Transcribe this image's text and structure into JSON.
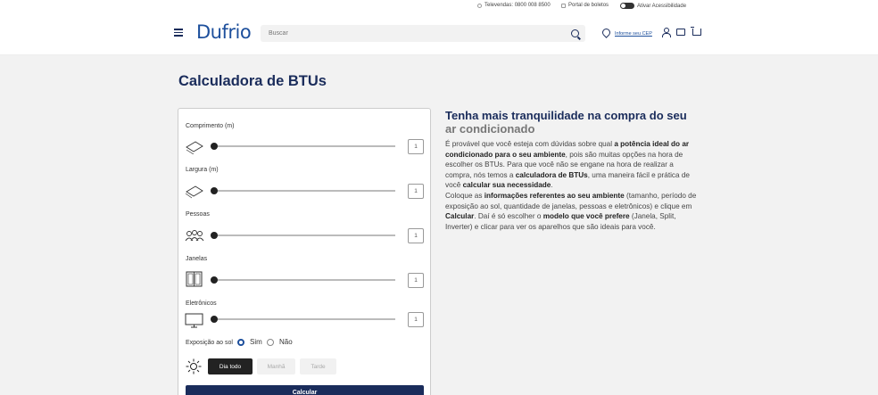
{
  "topbar": {
    "televendas": "Televendas: 0800 008 8500",
    "portal": "Portal de boletos",
    "acessibilidade": "Ativar Acessibilidade"
  },
  "header": {
    "logo": "Dufrio",
    "search_placeholder": "Buscar",
    "cep_link": "Informe seu CEP",
    "brand_color": "#1a2c5b"
  },
  "page_title": "Calculadora de BTUs",
  "calculator": {
    "fields": [
      {
        "label": "Comprimento (m)",
        "value": "1",
        "icon": "length-icon"
      },
      {
        "label": "Largura (m)",
        "value": "1",
        "icon": "width-icon"
      },
      {
        "label": "Pessoas",
        "value": "1",
        "icon": "people-icon"
      },
      {
        "label": "Janelas",
        "value": "1",
        "icon": "window-icon"
      },
      {
        "label": "Eletrônicos",
        "value": "1",
        "icon": "tv-icon"
      }
    ],
    "sun_exposure_label": "Exposição ao sol",
    "sun_yes": "Sim",
    "sun_no": "Não",
    "periods": [
      "Dia todo",
      "Manhã",
      "Tarde"
    ],
    "calculate_label": "Calcular"
  },
  "info": {
    "title_main": "Tenha mais tranquilidade na compra do seu",
    "title_grey": "ar condicionado",
    "p1_a": "É provável que você esteja com dúvidas sobre qual ",
    "p1_b": "a potência ideal do ar condicionado para o seu ambiente",
    "p1_c": ", pois são muitas opções na hora de escolher os BTUs. Para que você não se engane na hora de realizar a compra, nós temos a ",
    "p1_d": "calculadora de BTUs",
    "p1_e": ", uma maneira fácil e prática de você ",
    "p1_f": "calcular sua necessidade",
    "p1_g": ".",
    "p2_a": "Coloque as ",
    "p2_b": "informações referentes ao seu ambiente",
    "p2_c": " (tamanho, período de exposição ao sol, quantidade de janelas, pessoas e eletrônicos) e clique em ",
    "p2_d": "Calcular",
    "p2_e": ". Daí é só escolher o ",
    "p2_f": "modelo que você prefere",
    "p2_g": " (Janela, Split, Inverter) e clicar para ver os aparelhos que são ideais para você."
  }
}
